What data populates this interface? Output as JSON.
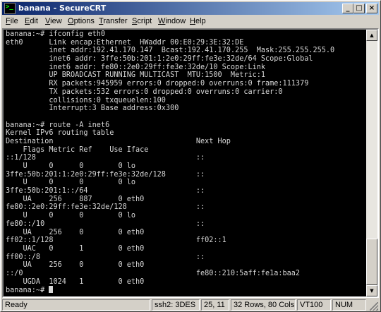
{
  "window": {
    "title": "banana - SecureCRT",
    "minimize_label": "_",
    "maximize_label": "□",
    "close_label": "×"
  },
  "menu": {
    "items": [
      {
        "ul": "F",
        "rest": "ile"
      },
      {
        "ul": "E",
        "rest": "dit"
      },
      {
        "ul": "V",
        "rest": "iew"
      },
      {
        "ul": "O",
        "rest": "ptions"
      },
      {
        "ul": "T",
        "rest": "ransfer"
      },
      {
        "ul": "S",
        "rest": "cript"
      },
      {
        "ul": "W",
        "rest": "indow"
      },
      {
        "ul": "H",
        "rest": "elp"
      }
    ]
  },
  "terminal": {
    "lines": [
      "banana:~# ifconfig eth0",
      "eth0      Link encap:Ethernet  HWaddr 00:E0:29:3E:32:DE",
      "          inet addr:192.41.170.147  Bcast:192.41.170.255  Mask:255.255.255.0",
      "          inet6 addr: 3ffe:50b:201:1:2e0:29ff:fe3e:32de/64 Scope:Global",
      "          inet6 addr: fe80::2e0:29ff:fe3e:32de/10 Scope:Link",
      "          UP BROADCAST RUNNING MULTICAST  MTU:1500  Metric:1",
      "          RX packets:945959 errors:0 dropped:0 overruns:0 frame:111379",
      "          TX packets:532 errors:0 dropped:0 overruns:0 carrier:0",
      "          collisions:0 txqueuelen:100",
      "          Interrupt:3 Base address:0x300",
      "",
      "banana:~# route -A inet6",
      "Kernel IPv6 routing table",
      "Destination                                 Next Hop",
      "    Flags Metric Ref    Use Iface",
      "::1/128                                     ::",
      "    U     0      0        0 lo",
      "3ffe:50b:201:1:2e0:29ff:fe3e:32de/128       ::",
      "    U     0      0        0 lo",
      "3ffe:50b:201:1::/64                         ::",
      "    UA    256    887      0 eth0",
      "fe80::2e0:29ff:fe3e:32de/128                ::",
      "    U     0      0        0 lo",
      "fe80::/10                                   ::",
      "    UA    256    0        0 eth0",
      "ff02::1/128                                 ff02::1",
      "    UAC   0      1        0 eth0",
      "ff00::/8                                    ::",
      "    UA    256    0        0 eth0",
      "::/0                                        fe80::210:5aff:fe1a:baa2",
      "    UGDA  1024   1        0 eth0"
    ],
    "prompt": "banana:~# "
  },
  "status": {
    "ready": "Ready",
    "protocol": "ssh2: 3DES",
    "cursor_pos": "25, 11",
    "dimensions": "32 Rows,  80 Cols",
    "emulation": "VT100",
    "caps": "NUM"
  },
  "colors": {
    "terminal_bg": "#000000",
    "terminal_fg": "#d8d8d8",
    "title_active": "#0a246a"
  }
}
